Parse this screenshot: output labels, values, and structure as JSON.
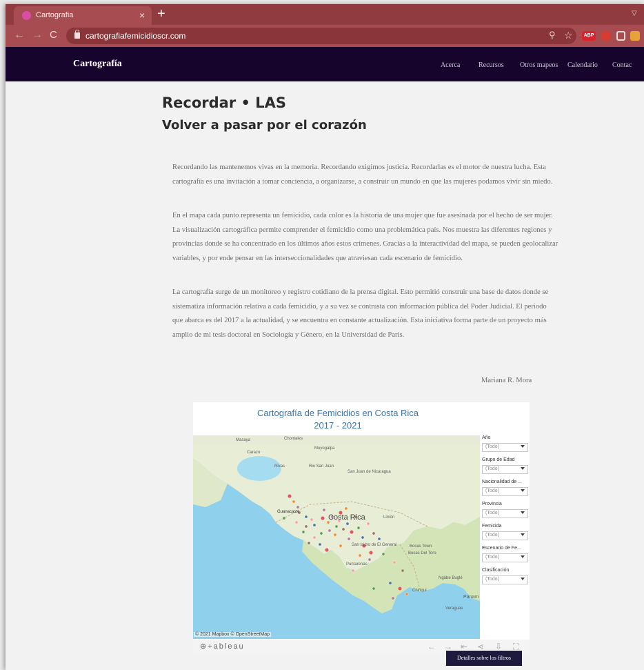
{
  "browser": {
    "tab_title": "Cartografia",
    "tab_close": "×",
    "new_tab": "+",
    "url": "cartografiafemicidioscr.com",
    "extension_badge": "ABP",
    "back_glyph": "←",
    "forward_glyph": "→",
    "reload_glyph": "C",
    "theme_color": "#a74d51"
  },
  "site": {
    "brand": "Cartografía",
    "nav": [
      "Acerca",
      "Recursos",
      "Otros mapeos",
      "Calendario",
      "Contac"
    ],
    "header_color": "#16042c"
  },
  "content": {
    "title": "Recordar • LAS",
    "subtitle": "Volver a pasar por el corazón",
    "paragraphs": [
      "Recordando las mantenemos vivas en la memoria. Recordando exigimos justicia. Recordarlas es el motor de nuestra lucha. Esta cartografía es una invitación a tomar conciencia, a organizarse, a construir un mundo en que las mujeres podamos vivir sin miedo.",
      "En el mapa cada punto representa un femicidio, cada color es la historia de una mujer que fue asesinada por el hecho de ser mujer. La visualización cartográfica permite comprender el femicidio como una problemática país. Nos muestra las diferentes regiones y provincias donde se ha concentrado en los últimos años estos crímenes. Gracias a la interactividad del mapa, se pueden geolocalizar variables, y por ende pensar en las interseccionalidades que atraviesan cada escenario de femicidio.",
      "La cartografía surge de un monitoreo y registro cotidiano de la prensa digital. Esto permitió construir una base de datos donde se sistematiza información relativa a cada femicidio, y a su vez se contrasta con información pública del Poder Judicial. El periodo que abarca es del 2017 a la actualidad, y se encuentra en constante actualización. Esta iniciativa forma parte de un proyecto más amplio de mi tesis doctoral en Sociología y Género, en la Universidad de Paris."
    ],
    "author": "Mariana R. Mora"
  },
  "viz": {
    "title_line1": "Cartografía de Femicidios en Costa Rica",
    "title_line2": "2017 - 2021",
    "map_labels": [
      "Masaya",
      "Chontales",
      "Carazo",
      "Rivas",
      "Rio San Juan",
      "San Juan de Nicaragua",
      "Moyogalpa",
      "Guanacaste",
      "Costa Rica",
      "Limón",
      "San Isidro de El General",
      "Puntarenas",
      "Bocas Town",
      "Bocas Del Toro",
      "Chiriquí",
      "Ngäbe Buglé",
      "Panam",
      "Veraguas"
    ],
    "map_credit": "© 2021 Mapbox © OpenStreetMap",
    "tableau_logo": "⊕+ableau",
    "filters": [
      {
        "label": "Año",
        "value": "(Todo)"
      },
      {
        "label": "Grupo de Edad",
        "value": "(Todo)"
      },
      {
        "label": "Nacionalidad de ...",
        "value": "(Todo)"
      },
      {
        "label": "Provincia",
        "value": "(Todo)"
      },
      {
        "label": "Femicida",
        "value": "(Todo)"
      },
      {
        "label": "Escenario de Fe...",
        "value": "(Todo)"
      },
      {
        "label": "Clasificación",
        "value": "(Todo)"
      }
    ],
    "marker_colors": [
      "#e15759",
      "#f28e2b",
      "#b07aa1",
      "#59a14f",
      "#ff9da7",
      "#9c755f",
      "#4e79a7"
    ]
  },
  "details_button": "Detalles sobre los filtros"
}
